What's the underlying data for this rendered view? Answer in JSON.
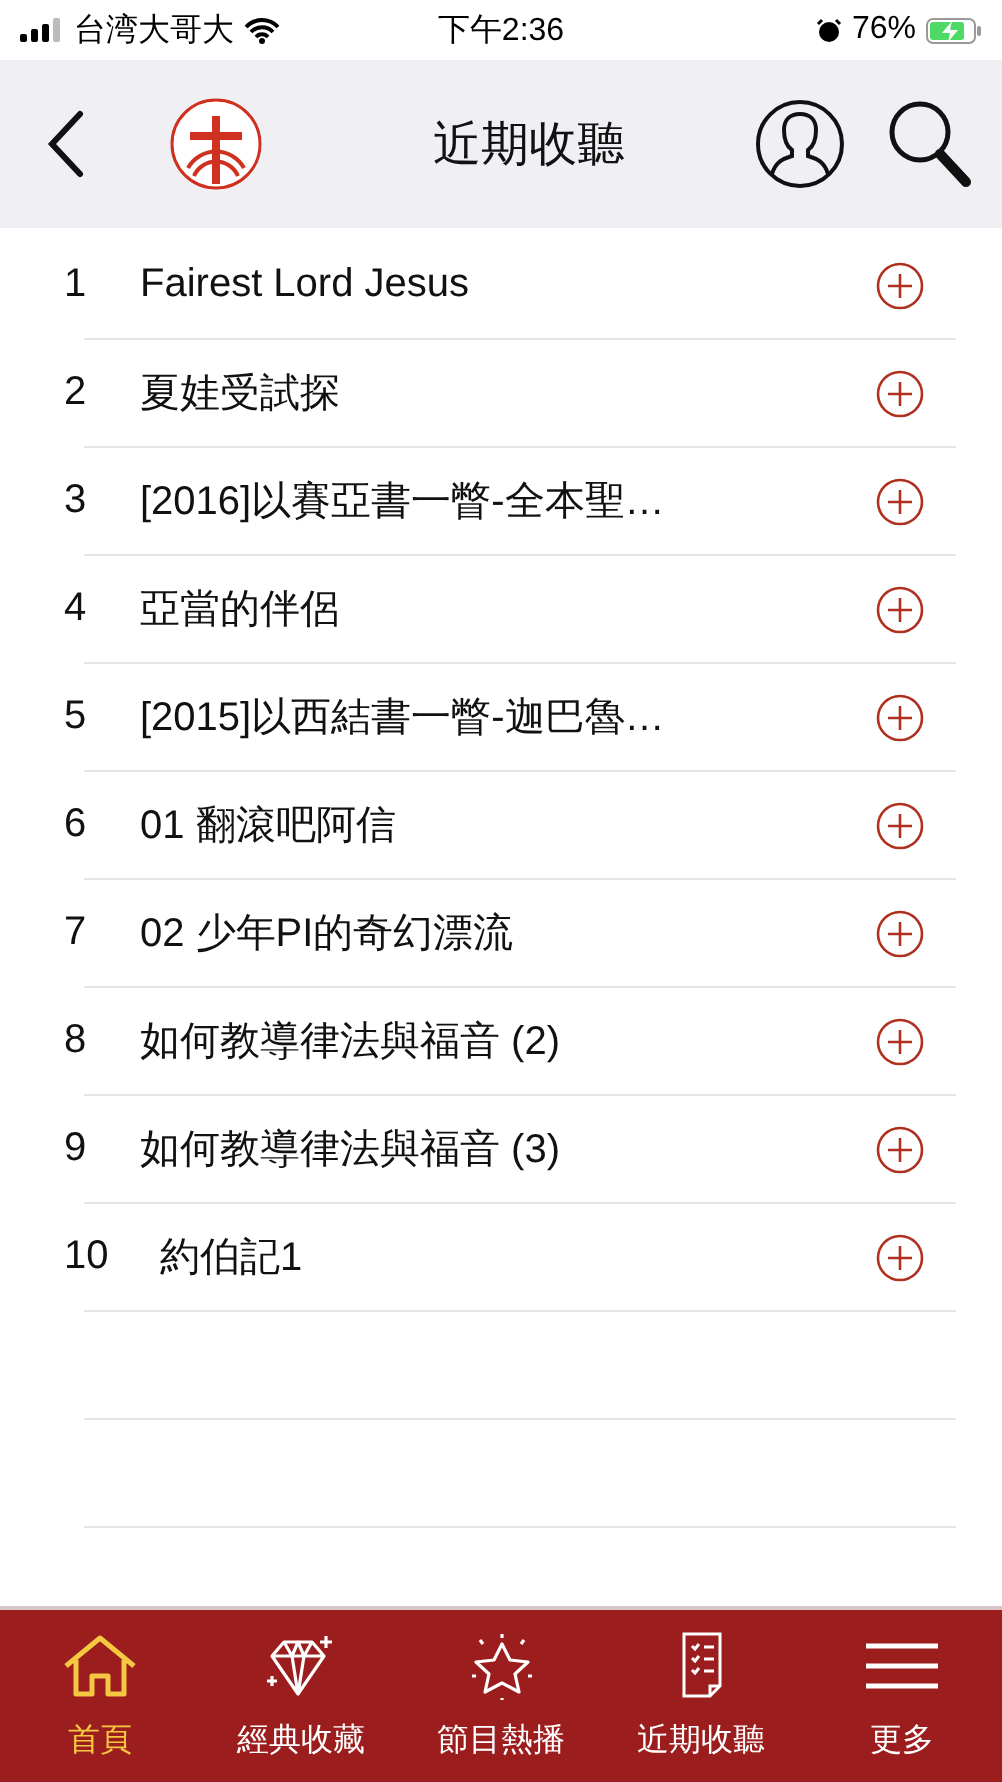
{
  "status_bar": {
    "carrier": "台湾大哥大",
    "time": "下午2:36",
    "battery": "76%"
  },
  "header": {
    "title": "近期收聽"
  },
  "items": [
    {
      "number": "1",
      "title": "Fairest Lord Jesus"
    },
    {
      "number": "2",
      "title": "夏娃受試探"
    },
    {
      "number": "3",
      "title": "[2016]以賽亞書一瞥-全本聖…"
    },
    {
      "number": "4",
      "title": "亞當的伴侶"
    },
    {
      "number": "5",
      "title": "[2015]以西結書一瞥-迦巴魯…"
    },
    {
      "number": "6",
      "title": "01 翻滾吧阿信"
    },
    {
      "number": "7",
      "title": "02 少年PI的奇幻漂流"
    },
    {
      "number": "8",
      "title": "如何教導律法與福音 (2)"
    },
    {
      "number": "9",
      "title": "如何教導律法與福音 (3)"
    },
    {
      "number": "10",
      "title": "約伯記1"
    }
  ],
  "tabs": [
    {
      "label": "首頁",
      "selected": true
    },
    {
      "label": "經典收藏",
      "selected": false
    },
    {
      "label": "節目熱播",
      "selected": false
    },
    {
      "label": "近期收聽",
      "selected": false
    },
    {
      "label": "更多",
      "selected": false
    }
  ]
}
